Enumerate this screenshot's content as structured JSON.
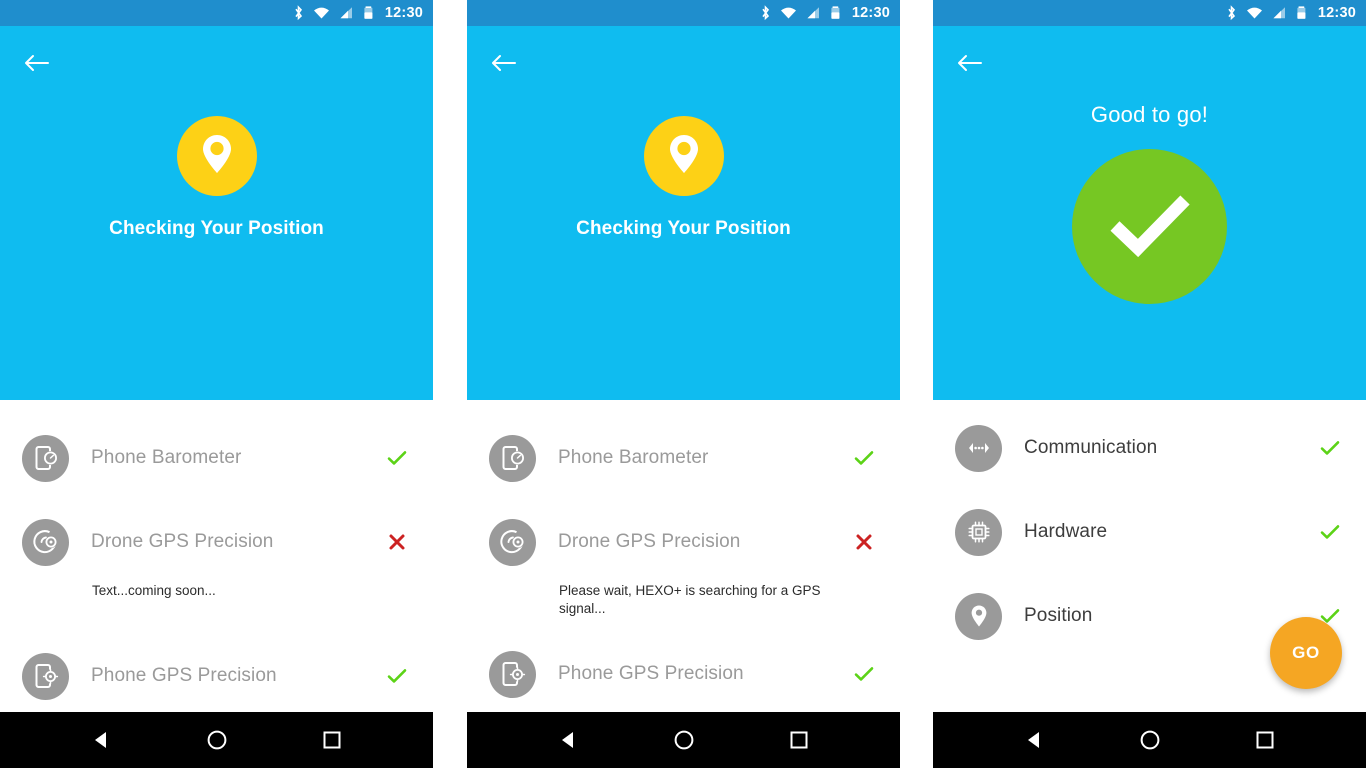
{
  "colors": {
    "status_bar": "#1f8ecd",
    "header": "#0fbcf0",
    "pin_circle": "#fdd116",
    "check_circle": "#76c723",
    "icon_circle": "#9a9a9a",
    "go_button": "#f5a623",
    "success": "#5cd317",
    "failure": "#cc2222",
    "nav_bar": "#000000",
    "label_muted": "#9a9a9a",
    "label_dark": "#3d3d3d"
  },
  "status_bar": {
    "clock": "12:30",
    "icons": [
      "bluetooth-icon",
      "wifi-icon",
      "cellular-signal-icon",
      "battery-icon"
    ]
  },
  "nav_bar": {
    "keys": [
      "back-triangle-icon",
      "home-circle-icon",
      "recents-square-icon"
    ]
  },
  "screens": [
    {
      "id": "checking-position-1",
      "back_label": "back-arrow-icon",
      "header": {
        "icon": "map-pin-icon",
        "title": "Checking Your Position"
      },
      "rows": [
        {
          "icon": "phone-barometer-icon",
          "label": "Phone Barometer",
          "status": "check",
          "status_symbol": "✔"
        },
        {
          "icon": "drone-gps-icon",
          "label": "Drone GPS Precision",
          "status": "cross",
          "status_symbol": "✖",
          "note": "Text...coming soon..."
        },
        {
          "icon": "phone-gps-icon",
          "label": "Phone GPS Precision",
          "status": "check",
          "status_symbol": "✔"
        }
      ]
    },
    {
      "id": "checking-position-2",
      "back_label": "back-arrow-icon",
      "header": {
        "icon": "map-pin-icon",
        "title": "Checking Your Position"
      },
      "rows": [
        {
          "icon": "phone-barometer-icon",
          "label": "Phone Barometer",
          "status": "check",
          "status_symbol": "✔"
        },
        {
          "icon": "drone-gps-icon",
          "label": "Drone GPS Precision",
          "status": "cross",
          "status_symbol": "✖",
          "note": "Please wait, HEXO+ is searching for a GPS signal..."
        },
        {
          "icon": "phone-gps-icon",
          "label": "Phone GPS Precision",
          "status": "check",
          "status_symbol": "✔"
        }
      ]
    },
    {
      "id": "good-to-go",
      "back_label": "back-arrow-icon",
      "header": {
        "icon": "success-check-icon",
        "title": "Good to go!"
      },
      "rows": [
        {
          "icon": "communication-icon",
          "label": "Communication",
          "status": "check",
          "status_symbol": "✔"
        },
        {
          "icon": "hardware-chip-icon",
          "label": "Hardware",
          "status": "check",
          "status_symbol": "✔"
        },
        {
          "icon": "position-pin-icon",
          "label": "Position",
          "status": "check",
          "status_symbol": "✔"
        }
      ],
      "go_button": {
        "label": "GO"
      }
    }
  ]
}
